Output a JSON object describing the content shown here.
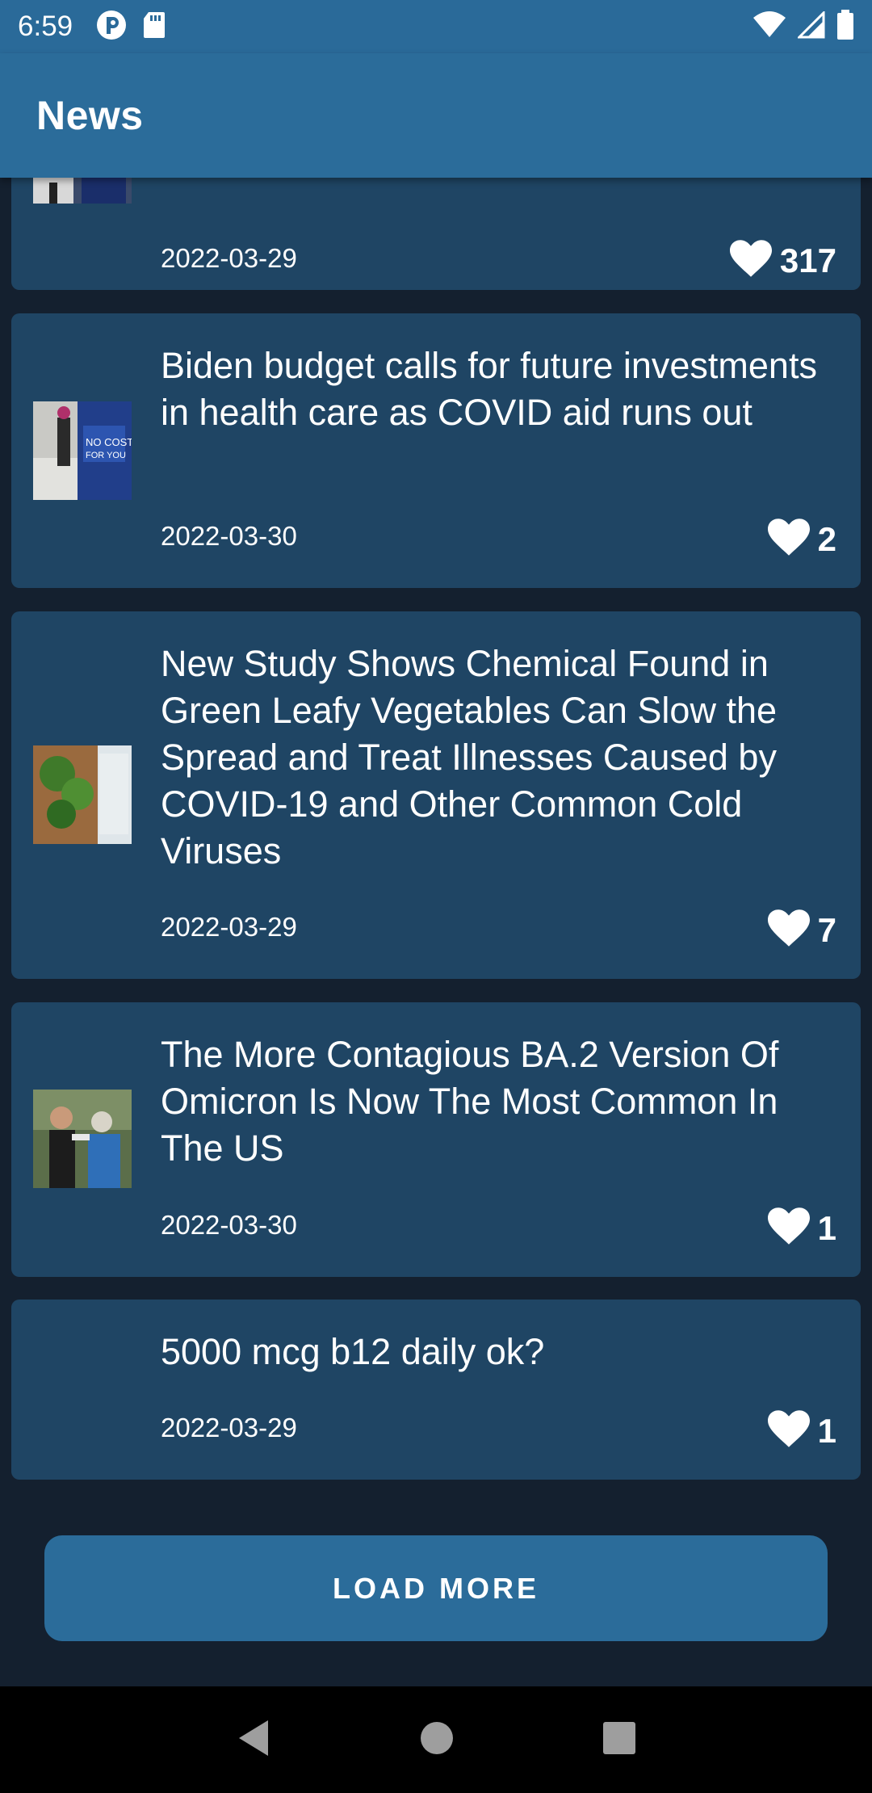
{
  "status_bar": {
    "time": "6:59"
  },
  "app_bar": {
    "title": "News"
  },
  "articles": [
    {
      "title": "",
      "date": "2022-03-29",
      "likes": "317"
    },
    {
      "title": "Biden budget calls for future investments in health care as COVID aid runs out",
      "date": "2022-03-30",
      "likes": "2"
    },
    {
      "title": "New Study Shows Chemical Found in Green Leafy Vegetables Can Slow the Spread and Treat Illnesses Caused by COVID-19 and Other Common Cold Viruses",
      "date": "2022-03-29",
      "likes": "7"
    },
    {
      "title": "The More Contagious BA.2 Version Of Omicron Is Now The Most Common In The US",
      "date": "2022-03-30",
      "likes": "1"
    },
    {
      "title": "5000 mcg b12 daily ok?",
      "date": "2022-03-29",
      "likes": "1"
    }
  ],
  "load_more": {
    "label": "LOAD MORE"
  },
  "icons": {
    "like": "heart-icon",
    "back": "back-icon",
    "home": "home-icon",
    "recents": "recents-icon"
  },
  "colors": {
    "app_bar": "#2b6c9a",
    "card": "#1f4564",
    "background": "#14202f"
  }
}
